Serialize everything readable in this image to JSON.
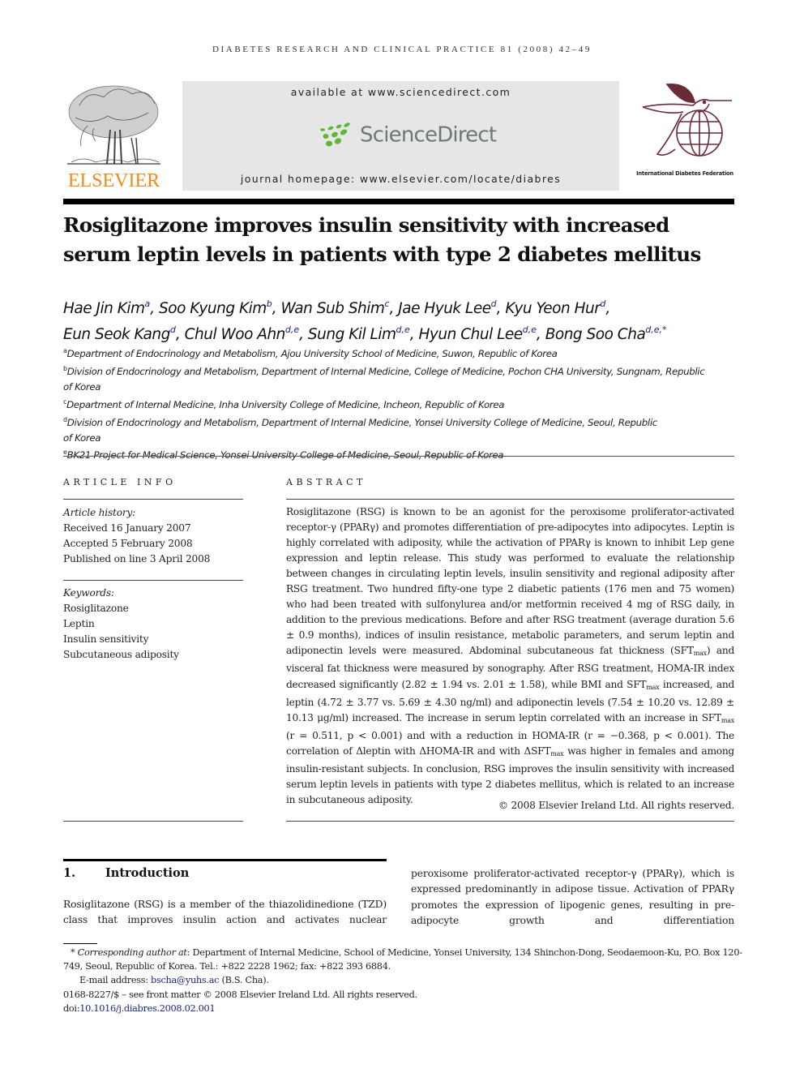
{
  "running_head": "DIABETES RESEARCH AND CLINICAL PRACTICE 81 (2008) 42–49",
  "banner": {
    "publisher": "ELSEVIER",
    "available_at": "available at www.sciencedirect.com",
    "sciencedirect_logo": "ScienceDirect",
    "journal_homepage": "journal homepage: www.elsevier.com/locate/diabres",
    "idf_name": "International Diabetes Federation",
    "colors": {
      "elsevier_orange": "#f28a1b",
      "sd_green": "#5cb82e",
      "sd_gray": "#6c7a74",
      "idf_maroon": "#6b2a37",
      "link_blue": "#1a237e"
    }
  },
  "article": {
    "title_line1": "Rosiglitazone improves insulin sensitivity with increased",
    "title_line2": "serum leptin levels in patients with type 2 diabetes mellitus",
    "authors": [
      {
        "name": "Hae Jin Kim",
        "sup": "a",
        "sep": ", "
      },
      {
        "name": "Soo Kyung Kim",
        "sup": "b",
        "sep": ", "
      },
      {
        "name": "Wan Sub Shim",
        "sup": "c",
        "sep": ", "
      },
      {
        "name": "Jae Hyuk Lee",
        "sup": "d",
        "sep": ", "
      },
      {
        "name": "Kyu Yeon Hur",
        "sup": "d",
        "sep": ","
      },
      {
        "name": "Eun Seok Kang",
        "sup": "d",
        "sep": ", "
      },
      {
        "name": "Chul Woo Ahn",
        "sup": "d,e",
        "sep": ", "
      },
      {
        "name": "Sung Kil Lim",
        "sup": "d,e",
        "sep": ", "
      },
      {
        "name": "Hyun Chul Lee",
        "sup": "d,e",
        "sep": ", "
      },
      {
        "name": "Bong Soo Cha",
        "sup": "d,e,*",
        "sep": ""
      }
    ],
    "affiliations": [
      {
        "key": "a",
        "text": "Department of Endocrinology and Metabolism, Ajou University School of Medicine, Suwon, Republic of Korea"
      },
      {
        "key": "b",
        "text": "Division of Endocrinology and Metabolism, Department of Internal Medicine, College of Medicine, Pochon CHA University, Sungnam, Republic of Korea"
      },
      {
        "key": "c",
        "text": "Department of Internal Medicine, Inha University College of Medicine, Incheon, Republic of Korea"
      },
      {
        "key": "d",
        "text": "Division of Endocrinology and Metabolism, Department of Internal Medicine, Yonsei University College of Medicine, Seoul, Republic of Korea"
      },
      {
        "key": "e",
        "text": "BK21 Project for Medical Science, Yonsei University College of Medicine, Seoul, Republic of Korea"
      }
    ]
  },
  "article_info": {
    "heading": "ARTICLE INFO",
    "history_label": "Article history:",
    "history": [
      "Received 16 January 2007",
      "Accepted 5 February 2008",
      "Published on line 3 April 2008"
    ],
    "keywords_label": "Keywords:",
    "keywords": [
      "Rosiglitazone",
      "Leptin",
      "Insulin sensitivity",
      "Subcutaneous adiposity"
    ]
  },
  "abstract": {
    "heading": "ABSTRACT",
    "p1": "Rosiglitazone (RSG) is known to be an agonist for the peroxisome proliferator-activated receptor-γ (PPARγ) and promotes differentiation of pre-adipocytes into adipocytes. Leptin is highly correlated with adiposity, while the activation of PPARγ is known to inhibit Lep gene expression and leptin release. This study was performed to evaluate the relationship between changes in circulating leptin levels, insulin sensitivity and regional adiposity after RSG treatment. Two hundred fifty-one type 2 diabetic patients (176 men and 75 women) who had been treated with sulfonylurea and/or metformin received 4 mg of RSG daily, in addition to the previous medications. Before and after RSG treatment (average duration 5.6 ± 0.9 months), indices of insulin resistance, metabolic parameters, and serum leptin and adiponectin levels were measured. Abdominal subcutaneous fat thickness (SFT",
    "sub1": "max",
    "p2": ") and visceral fat thickness were measured by sonography. After RSG treatment, HOMA-IR index decreased significantly (2.82 ± 1.94 vs. 2.01 ± 1.58), while BMI and SFT",
    "sub2": "max",
    "p3": " increased, and leptin (4.72 ± 3.77 vs. 5.69 ± 4.30 ng/ml) and adiponectin levels (7.54 ± 10.20 vs. 12.89 ± 10.13 μg/ml) increased. The increase in serum leptin correlated with an increase in SFT",
    "sub3": "max",
    "p4": " (r = 0.511, p < 0.001) and with a reduction in HOMA-IR (r = −0.368, p < 0.001). The correlation of Δleptin with ΔHOMA-IR and with ΔSFT",
    "sub4": "max",
    "p5": " was higher in females and among insulin-resistant subjects. In conclusion, RSG improves the insulin sensitivity with increased serum leptin levels in patients with type 2 diabetes mellitus, which is related to an increase in subcutaneous adiposity.",
    "copyright": "© 2008 Elsevier Ireland Ltd. All rights reserved."
  },
  "introduction": {
    "number": "1.",
    "heading": "Introduction",
    "left_text": "Rosiglitazone (RSG) is a member of the thiazolidinedione (TZD) class that improves insulin action and activates nuclear",
    "right_text": "peroxisome proliferator-activated receptor-γ (PPARγ), which is expressed predominantly in adipose tissue. Activation of PPARγ promotes the expression of lipogenic genes, resulting in pre-adipocyte growth and differentiation"
  },
  "footnotes": {
    "corr_mark": "*",
    "corr_label": "Corresponding author at",
    "corr_text": ": Department of Internal Medicine, School of Medicine, Yonsei University, 134 Shinchon-Dong, Seodaemoon-Ku, P.O. Box 120-749, Seoul, Republic of Korea. Tel.: +822 2228 1962; fax: +822 393 6884.",
    "email_label": "E-mail address: ",
    "email": "bscha@yuhs.ac",
    "email_suffix": " (B.S. Cha).",
    "issn_line": "0168-8227/$ – see front matter © 2008 Elsevier Ireland Ltd. All rights reserved.",
    "doi_prefix": "doi:",
    "doi": "10.1016/j.diabres.2008.02.001"
  }
}
